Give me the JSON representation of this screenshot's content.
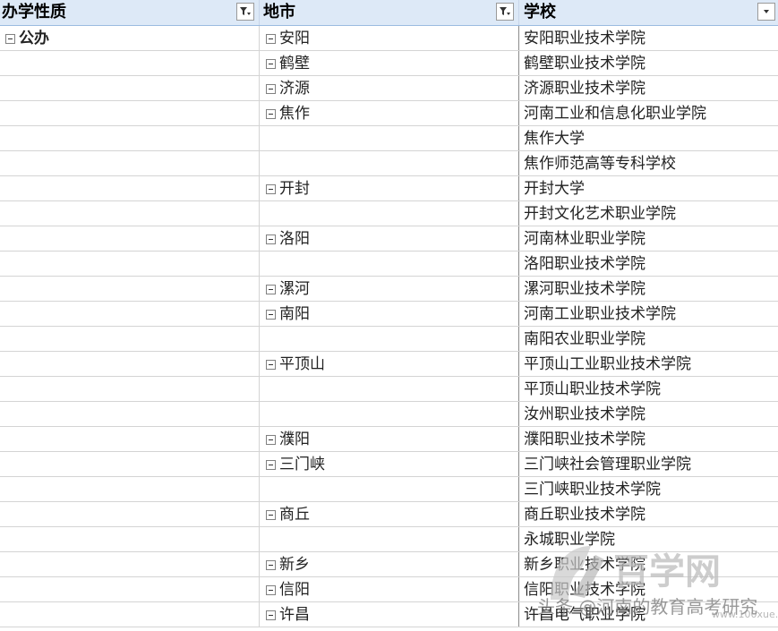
{
  "header": {
    "col1": "办学性质",
    "col2": "地市",
    "col3": "学校"
  },
  "icons": {
    "collapse": "minus-box-icon",
    "filter": "funnel-filter-icon",
    "dropdown": "chevron-down-icon"
  },
  "rows": [
    {
      "nature": "公办",
      "city": "安阳",
      "school": "安阳职业技术学院"
    },
    {
      "nature": "",
      "city": "鹤壁",
      "school": "鹤壁职业技术学院"
    },
    {
      "nature": "",
      "city": "济源",
      "school": "济源职业技术学院"
    },
    {
      "nature": "",
      "city": "焦作",
      "school": "河南工业和信息化职业学院"
    },
    {
      "nature": "",
      "city": "",
      "school": "焦作大学"
    },
    {
      "nature": "",
      "city": "",
      "school": "焦作师范高等专科学校"
    },
    {
      "nature": "",
      "city": "开封",
      "school": "开封大学"
    },
    {
      "nature": "",
      "city": "",
      "school": "开封文化艺术职业学院"
    },
    {
      "nature": "",
      "city": "洛阳",
      "school": "河南林业职业学院"
    },
    {
      "nature": "",
      "city": "",
      "school": "洛阳职业技术学院"
    },
    {
      "nature": "",
      "city": "漯河",
      "school": "漯河职业技术学院"
    },
    {
      "nature": "",
      "city": "南阳",
      "school": "河南工业职业技术学院"
    },
    {
      "nature": "",
      "city": "",
      "school": "南阳农业职业学院"
    },
    {
      "nature": "",
      "city": "平顶山",
      "school": "平顶山工业职业技术学院"
    },
    {
      "nature": "",
      "city": "",
      "school": "平顶山职业技术学院"
    },
    {
      "nature": "",
      "city": "",
      "school": "汝州职业技术学院"
    },
    {
      "nature": "",
      "city": "濮阳",
      "school": "濮阳职业技术学院"
    },
    {
      "nature": "",
      "city": "三门峡",
      "school": "三门峡社会管理职业学院"
    },
    {
      "nature": "",
      "city": "",
      "school": "三门峡职业技术学院"
    },
    {
      "nature": "",
      "city": "商丘",
      "school": "商丘职业技术学院"
    },
    {
      "nature": "",
      "city": "",
      "school": "永城职业学院"
    },
    {
      "nature": "",
      "city": "新乡",
      "school": "新乡职业技术学院"
    },
    {
      "nature": "",
      "city": "信阳",
      "school": "信阳职业技术学院"
    },
    {
      "nature": "",
      "city": "许昌",
      "school": "许昌电气职业学院"
    }
  ],
  "watermark": {
    "logo_text": "百学网",
    "caption": "头条 @河南的教育高考研究",
    "url": "www.100xue.net"
  }
}
